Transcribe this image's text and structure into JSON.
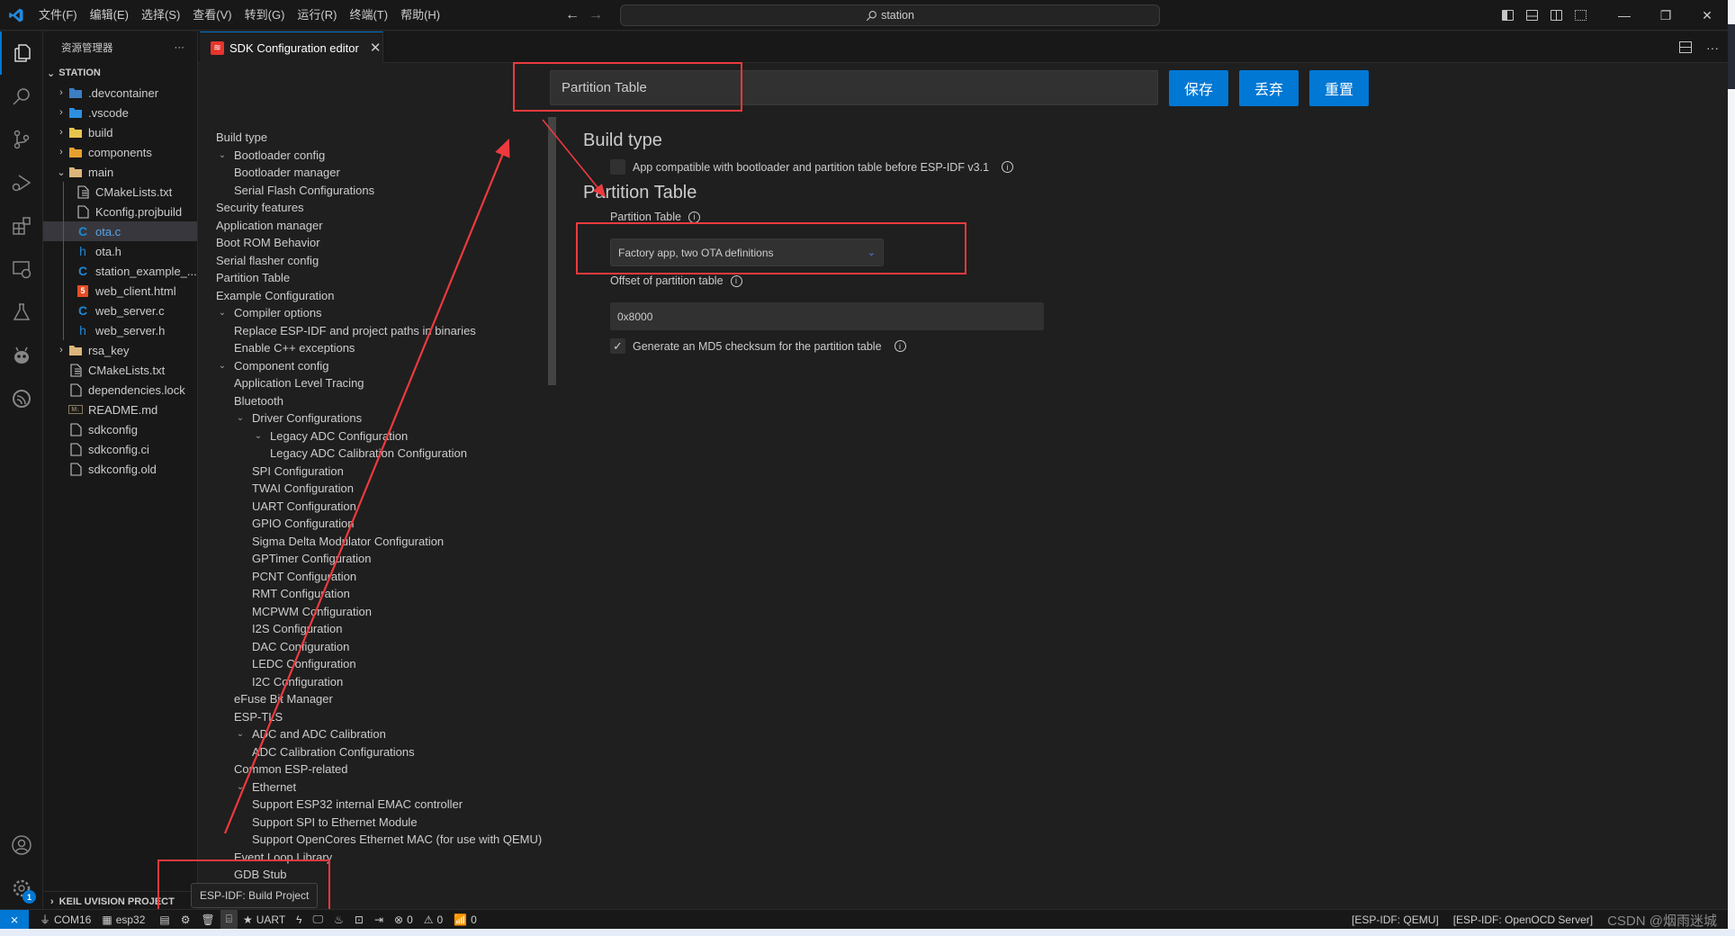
{
  "titlebar": {
    "menus": [
      "文件(F)",
      "编辑(E)",
      "选择(S)",
      "查看(V)",
      "转到(G)",
      "运行(R)",
      "终端(T)",
      "帮助(H)"
    ],
    "search": "station",
    "nav_back": "←",
    "nav_forward": "→",
    "window_controls": {
      "minimize": "—",
      "restore": "❐",
      "close": "✕"
    }
  },
  "activity_bar": {
    "items": [
      "explorer-icon",
      "search-icon",
      "source-control-icon",
      "run-debug-icon",
      "extensions-icon",
      "remote-explorer-icon",
      "testing-icon",
      "platformio-icon",
      "espressif-icon"
    ],
    "bottom": [
      "account-icon",
      "settings-gear-icon"
    ],
    "settings_badge": "1"
  },
  "sidebar": {
    "title": "资源管理器",
    "more": "···",
    "section": "STATION",
    "tree": [
      {
        "label": ".devcontainer",
        "type": "folder",
        "depth": 0,
        "twisty": "›",
        "icon": "devcontainer-folder-icon",
        "color": "#3c7ec4"
      },
      {
        "label": ".vscode",
        "type": "folder",
        "depth": 0,
        "twisty": "›",
        "icon": "vscode-folder-icon",
        "color": "#2d8fe0"
      },
      {
        "label": "build",
        "type": "folder",
        "depth": 0,
        "twisty": "›",
        "icon": "build-folder-icon",
        "color": "#e8c54d"
      },
      {
        "label": "components",
        "type": "folder",
        "depth": 0,
        "twisty": "›",
        "icon": "components-folder-icon",
        "color": "#e6a030"
      },
      {
        "label": "main",
        "type": "folder-open",
        "depth": 0,
        "twisty": "⌄",
        "icon": "folder-open-icon",
        "color": "#dcb67a"
      },
      {
        "label": "CMakeLists.txt",
        "type": "file",
        "depth": 1,
        "icon": "text-file-icon",
        "color": "#c5c5c5"
      },
      {
        "label": "Kconfig.projbuild",
        "type": "file",
        "depth": 1,
        "icon": "file-icon",
        "color": "#c5c5c5"
      },
      {
        "label": "ota.c",
        "type": "file",
        "depth": 1,
        "icon": "c-file-icon",
        "glyph": "C",
        "color": "#1e88d6",
        "selected": true
      },
      {
        "label": "ota.h",
        "type": "file",
        "depth": 1,
        "icon": "h-file-icon",
        "glyph": "h",
        "color": "#1e88d6"
      },
      {
        "label": "station_example_...",
        "type": "file",
        "depth": 1,
        "icon": "c-file-icon",
        "glyph": "C",
        "color": "#1e88d6"
      },
      {
        "label": "web_client.html",
        "type": "file",
        "depth": 1,
        "icon": "html-file-icon",
        "glyph": "5",
        "color": "#e44d26"
      },
      {
        "label": "web_server.c",
        "type": "file",
        "depth": 1,
        "icon": "c-file-icon",
        "glyph": "C",
        "color": "#1e88d6"
      },
      {
        "label": "web_server.h",
        "type": "file",
        "depth": 1,
        "icon": "h-file-icon",
        "glyph": "h",
        "color": "#1e88d6"
      },
      {
        "label": "rsa_key",
        "type": "folder",
        "depth": 0,
        "twisty": "›",
        "icon": "folder-icon",
        "color": "#dcb67a"
      },
      {
        "label": "CMakeLists.txt",
        "type": "file",
        "depth": 0,
        "icon": "text-file-icon",
        "color": "#c5c5c5"
      },
      {
        "label": "dependencies.lock",
        "type": "file",
        "depth": 0,
        "icon": "file-icon",
        "color": "#c5c5c5"
      },
      {
        "label": "README.md",
        "type": "file",
        "depth": 0,
        "icon": "markdown-file-icon",
        "glyph": "M↓",
        "color": "#8a7a5c"
      },
      {
        "label": "sdkconfig",
        "type": "file",
        "depth": 0,
        "icon": "file-icon",
        "color": "#c5c5c5"
      },
      {
        "label": "sdkconfig.ci",
        "type": "file",
        "depth": 0,
        "icon": "file-icon",
        "color": "#c5c5c5"
      },
      {
        "label": "sdkconfig.old",
        "type": "file",
        "depth": 0,
        "icon": "file-icon",
        "color": "#c5c5c5"
      }
    ],
    "footer": "KEIL UVISION PROJECT"
  },
  "tabs": [
    {
      "label": "SDK Configuration editor",
      "active": true
    }
  ],
  "editor": {
    "search_value": "Partition Table",
    "buttons": {
      "save": "保存",
      "discard": "丢弃",
      "reset": "重置"
    },
    "menu_tree": [
      {
        "label": "Build type",
        "depth": 0
      },
      {
        "label": "Bootloader config",
        "depth": 1,
        "expanded": true
      },
      {
        "label": "Bootloader manager",
        "depth": 1
      },
      {
        "label": "Serial Flash Configurations",
        "depth": 1
      },
      {
        "label": "Security features",
        "depth": 0
      },
      {
        "label": "Application manager",
        "depth": 0
      },
      {
        "label": "Boot ROM Behavior",
        "depth": 0
      },
      {
        "label": "Serial flasher config",
        "depth": 0
      },
      {
        "label": "Partition Table",
        "depth": 0
      },
      {
        "label": "Example Configuration",
        "depth": 0
      },
      {
        "label": "Compiler options",
        "depth": 1,
        "expanded": true
      },
      {
        "label": "Replace ESP-IDF and project paths in binaries",
        "depth": 1
      },
      {
        "label": "Enable C++ exceptions",
        "depth": 1
      },
      {
        "label": "Component config",
        "depth": 1,
        "expanded": true
      },
      {
        "label": "Application Level Tracing",
        "depth": 1
      },
      {
        "label": "Bluetooth",
        "depth": 1
      },
      {
        "label": "Driver Configurations",
        "depth": 2,
        "expanded": true
      },
      {
        "label": "Legacy ADC Configuration",
        "depth": 3,
        "expanded": true
      },
      {
        "label": "Legacy ADC Calibration Configuration",
        "depth": 3
      },
      {
        "label": "SPI Configuration",
        "depth": 2
      },
      {
        "label": "TWAI Configuration",
        "depth": 2
      },
      {
        "label": "UART Configuration",
        "depth": 2
      },
      {
        "label": "GPIO Configuration",
        "depth": 2
      },
      {
        "label": "Sigma Delta Modulator Configuration",
        "depth": 2
      },
      {
        "label": "GPTimer Configuration",
        "depth": 2
      },
      {
        "label": "PCNT Configuration",
        "depth": 2
      },
      {
        "label": "RMT Configuration",
        "depth": 2
      },
      {
        "label": "MCPWM Configuration",
        "depth": 2
      },
      {
        "label": "I2S Configuration",
        "depth": 2
      },
      {
        "label": "DAC Configuration",
        "depth": 2
      },
      {
        "label": "LEDC Configuration",
        "depth": 2
      },
      {
        "label": "I2C Configuration",
        "depth": 2
      },
      {
        "label": "eFuse Bit Manager",
        "depth": 1
      },
      {
        "label": "ESP-TLS",
        "depth": 1
      },
      {
        "label": "ADC and ADC Calibration",
        "depth": 2,
        "expanded": true
      },
      {
        "label": "ADC Calibration Configurations",
        "depth": 2
      },
      {
        "label": "Common ESP-related",
        "depth": 1
      },
      {
        "label": "Ethernet",
        "depth": 2,
        "expanded": true
      },
      {
        "label": "Support ESP32 internal EMAC controller",
        "depth": 2
      },
      {
        "label": "Support SPI to Ethernet Module",
        "depth": 2
      },
      {
        "label": "Support OpenCores Ethernet MAC (for use with QEMU)",
        "depth": 2
      },
      {
        "label": "Event Loop Library",
        "depth": 1
      },
      {
        "label": "GDB Stub",
        "depth": 1
      }
    ],
    "content": {
      "build_type_heading": "Build type",
      "app_compat_label": "App compatible with bootloader and partition table before ESP-IDF v3.1",
      "app_compat_checked": false,
      "partition_heading": "Partition Table",
      "partition_table_label": "Partition Table",
      "partition_table_value": "Factory app, two OTA definitions",
      "offset_label": "Offset of partition table",
      "offset_value": "0x8000",
      "md5_label": "Generate an MD5 checksum for the partition table",
      "md5_checked": true,
      "check_glyph": "✓"
    }
  },
  "tooltip": "ESP-IDF: Build Project",
  "statusbar": {
    "remote_icon": "⨯",
    "left": [
      {
        "icon": "plug-icon",
        "glyph": "⏚",
        "label": "COM16"
      },
      {
        "icon": "chip-icon",
        "glyph": "▦",
        "label": "esp32"
      },
      {
        "icon": "sdkconfig-icon",
        "glyph": "▤",
        "label": ""
      },
      {
        "icon": "gear-icon",
        "glyph": "⚙",
        "label": ""
      },
      {
        "icon": "trash-icon",
        "glyph": "🗑",
        "label": ""
      },
      {
        "icon": "build-cylinder-icon",
        "glyph": "⌸",
        "label": "",
        "highlight": true
      },
      {
        "icon": "star-icon",
        "glyph": "★",
        "label": "UART"
      },
      {
        "icon": "flash-icon",
        "glyph": "ϟ",
        "label": ""
      },
      {
        "icon": "monitor-icon",
        "glyph": "🖵",
        "label": ""
      },
      {
        "icon": "flame-icon",
        "glyph": "♨",
        "label": ""
      },
      {
        "icon": "terminal-icon",
        "glyph": "⊡",
        "label": ""
      },
      {
        "icon": "run-arrow-icon",
        "glyph": "⇥",
        "label": ""
      },
      {
        "icon": "errors-icon",
        "glyph": "⊗",
        "label": "0"
      },
      {
        "icon": "warnings-icon",
        "glyph": "⚠",
        "label": "0"
      },
      {
        "icon": "antenna-icon",
        "glyph": "📶",
        "label": "0"
      }
    ],
    "right": [
      "[ESP-IDF: QEMU]",
      "[ESP-IDF: OpenOCD Server]"
    ],
    "watermark": "CSDN @烟雨迷城"
  },
  "colors": {
    "accent": "#0078d4",
    "annotation": "#ec3a3f",
    "background": "#1f1f1f",
    "sidebar": "#181818"
  }
}
